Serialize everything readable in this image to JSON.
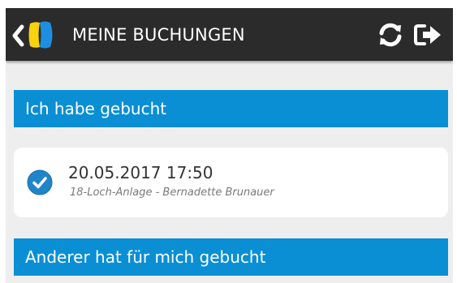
{
  "header": {
    "title": "MEINE BUCHUNGEN",
    "back_icon": "chevron-left-icon",
    "logo_icon": "app-logo-icon",
    "refresh_icon": "refresh-icon",
    "logout_icon": "logout-icon"
  },
  "sections": [
    {
      "title": "Ich habe gebucht",
      "bookings": [
        {
          "datetime": "20.05.2017 17:50",
          "subtitle": "18-Loch-Anlage - Bernadette Brunauer",
          "status_icon": "check-circle-icon"
        }
      ]
    },
    {
      "title": "Anderer hat für mich gebucht",
      "bookings": []
    }
  ],
  "colors": {
    "topbar": "#2b2b2b",
    "accent": "#0a8fd5",
    "background": "#eeeeee",
    "card": "#ffffff",
    "logo_yellow": "#f6d20f",
    "logo_blue": "#1e8fe0"
  }
}
